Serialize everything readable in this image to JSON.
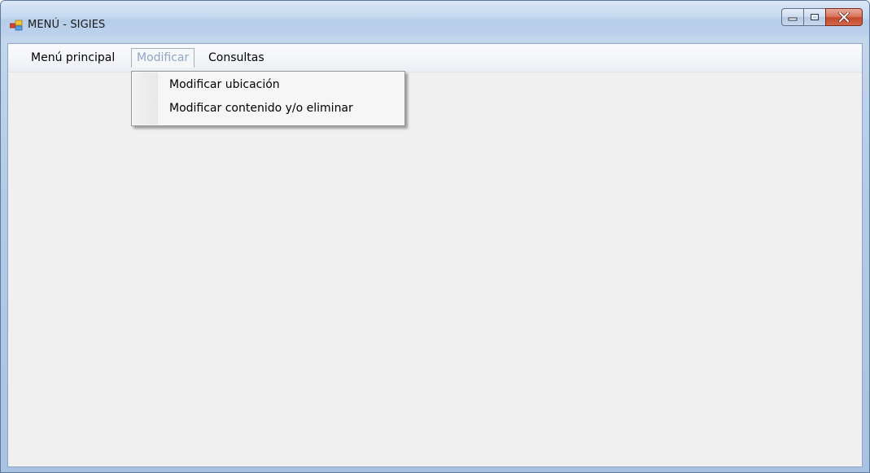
{
  "window": {
    "title": "MENÚ - SIGIES",
    "icon": "app-window-icon",
    "controls": [
      "minimize-icon",
      "maximize-icon",
      "close-icon"
    ]
  },
  "menubar": {
    "items": [
      {
        "label": "Menú principal",
        "state": "normal"
      },
      {
        "label": "Modificar",
        "state": "open"
      },
      {
        "label": "Consultas",
        "state": "normal"
      }
    ]
  },
  "dropdown": {
    "parent": "Modificar",
    "items": [
      {
        "label": "Modificar ubicación"
      },
      {
        "label": "Modificar contenido y/o eliminar"
      }
    ]
  },
  "colors": {
    "titlebar": "#c4d8ef",
    "client_background": "#f0f0f0",
    "open_menu_text": "#8fa6c6",
    "close_button": "#c24a2c"
  }
}
